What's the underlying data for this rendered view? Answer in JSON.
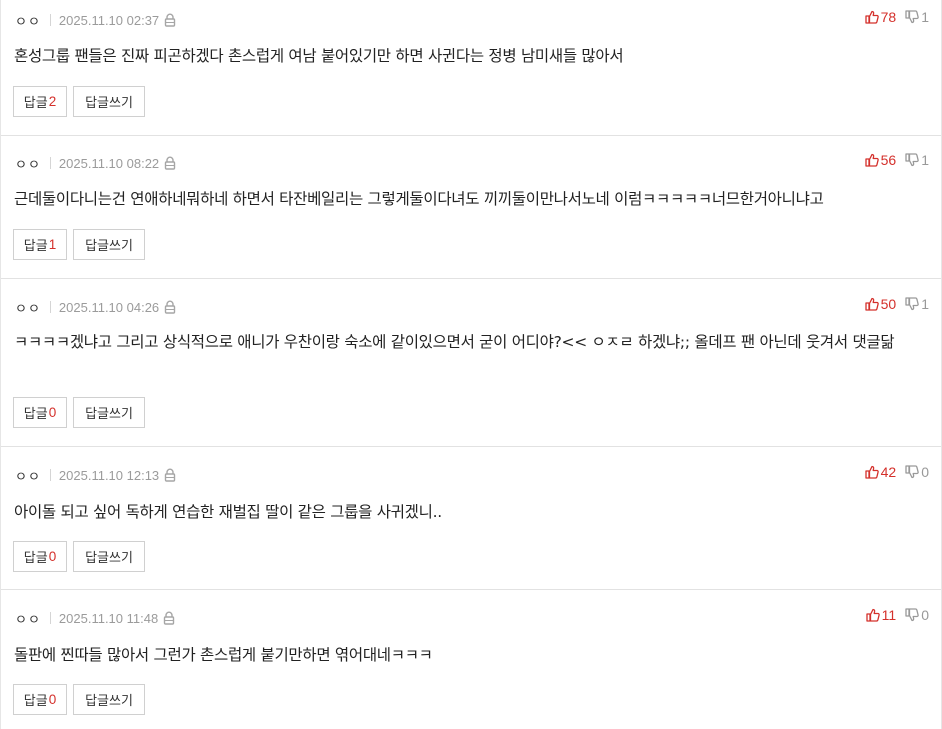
{
  "comments": [
    {
      "nick": "ㅇㅇ",
      "date": "2025.11.10 02:37",
      "up": "78",
      "down": "1",
      "text": "혼성그룹 팬들은 진짜 피곤하겠다 촌스럽게 여남 붙어있기만 하면 사귄다는 정병 남미새들 많아서",
      "reply_label": "답글",
      "reply_count": "2",
      "write_label": "답글쓰기"
    },
    {
      "nick": "ㅇㅇ",
      "date": "2025.11.10 08:22",
      "up": "56",
      "down": "1",
      "text": "근데둘이다니는건 연애하네뭐하네 하면서 타잔베일리는 그렇게둘이다녀도 끼끼둘이만나서노네 이럼ㅋㅋㅋㅋㅋ너므한거아니냐고",
      "reply_label": "답글",
      "reply_count": "1",
      "write_label": "답글쓰기"
    },
    {
      "nick": "ㅇㅇ",
      "date": "2025.11.10 04:26",
      "up": "50",
      "down": "1",
      "text": "ㅋㅋㅋㅋ겠냐고 그리고 상식적으로 애니가 우찬이랑 숙소에 같이있으면서 굳이 어디야?<< ㅇㅈㄹ 하겠냐;; 올데프 팬 아닌데 웃겨서 댓글닮",
      "reply_label": "답글",
      "reply_count": "0",
      "write_label": "답글쓰기"
    },
    {
      "nick": "ㅇㅇ",
      "date": "2025.11.10 12:13",
      "up": "42",
      "down": "0",
      "text": "아이돌 되고 싶어 독하게 연습한 재벌집 딸이 같은 그룹을 사귀겠니..",
      "reply_label": "답글",
      "reply_count": "0",
      "write_label": "답글쓰기"
    },
    {
      "nick": "ㅇㅇ",
      "date": "2025.11.10 11:48",
      "up": "11",
      "down": "0",
      "text": "돌판에 찐따들 많아서 그런가 촌스럽게 붙기만하면 엮어대네ㅋㅋㅋ",
      "reply_label": "답글",
      "reply_count": "0",
      "write_label": "답글쓰기"
    }
  ],
  "icons": {
    "up": "thumbs-up-icon",
    "down": "thumbs-down-icon",
    "lock": "lock-icon"
  },
  "colors": {
    "accent": "#d4302b",
    "muted": "#9b9b9b",
    "border": "#d0d0d0"
  }
}
